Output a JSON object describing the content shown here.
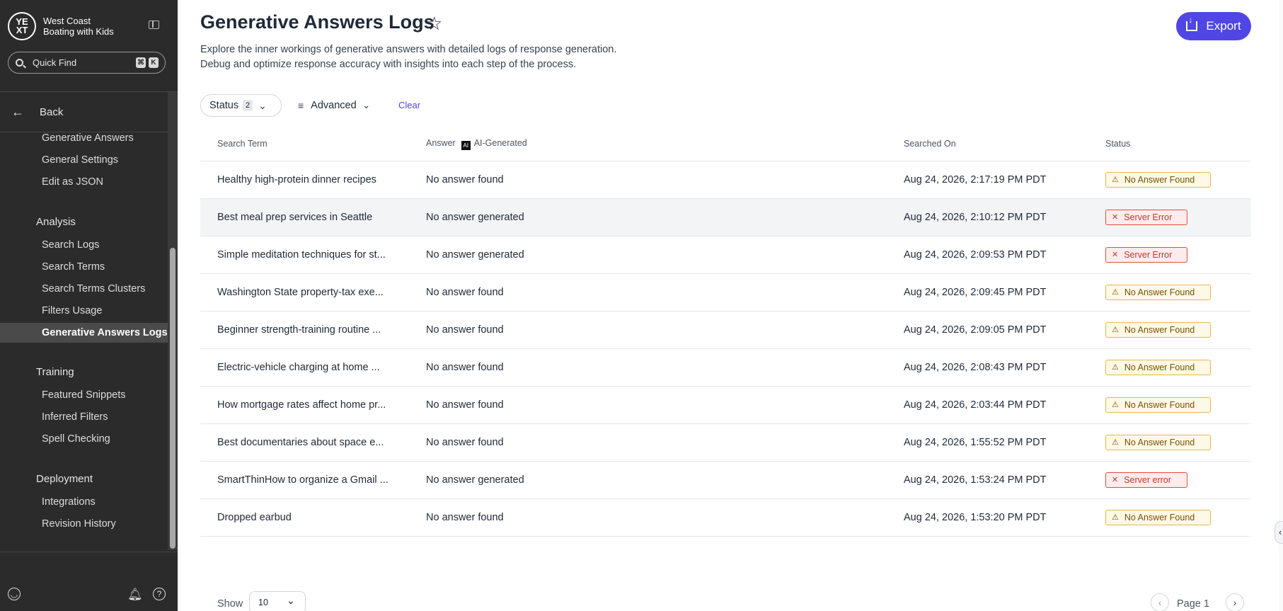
{
  "sidebar": {
    "logo_text": "YE\nXT",
    "brand_line1": "West Coast",
    "brand_line2": "Boating with Kids",
    "quick_find": "Quick Find",
    "kbd1": "⌘",
    "kbd2": "K",
    "back_label": "Back",
    "items_top": [
      "Generative Answers",
      "General Settings",
      "Edit as JSON"
    ],
    "analysis": {
      "title": "Analysis",
      "items": [
        "Search Logs",
        "Search Terms",
        "Search Terms Clusters",
        "Filters Usage",
        "Generative Answers Logs"
      ]
    },
    "training": {
      "title": "Training",
      "items": [
        "Featured Snippets",
        "Inferred Filters",
        "Spell Checking"
      ]
    },
    "deployment": {
      "title": "Deployment",
      "items": [
        "Integrations",
        "Revision History"
      ]
    }
  },
  "header": {
    "title": "Generative Answers Logs",
    "subtitle_line1": "Explore the inner workings of generative answers with detailed logs of response generation.",
    "subtitle_line2": "Debug and optimize response accuracy with insights into each step of the process.",
    "export_label": "Export"
  },
  "filters": {
    "status_label": "Status",
    "status_count": "2",
    "advanced_label": "Advanced",
    "clear_label": "Clear"
  },
  "table": {
    "columns": {
      "search_term": "Search Term",
      "answer": "Answer",
      "ai_generated": "AI-Generated",
      "ai_icon": "AI",
      "searched_on": "Searched On",
      "status": "Status"
    },
    "rows": [
      {
        "term": "Healthy high-protein dinner recipes",
        "answer": "No answer found",
        "date": "Aug 24, 2026, 2:17:19 PM PDT",
        "status": "No Answer Found",
        "type": "warn"
      },
      {
        "term": "Best meal prep services in Seattle",
        "answer": "No answer generated",
        "date": "Aug 24, 2026, 2:10:12 PM PDT",
        "status": "Server Error",
        "type": "err"
      },
      {
        "term": "Simple meditation techniques for st...",
        "answer": "No answer generated",
        "date": "Aug 24, 2026, 2:09:53 PM PDT",
        "status": "Server Error",
        "type": "err"
      },
      {
        "term": "Washington State property-tax exe...",
        "answer": "No answer found",
        "date": "Aug 24, 2026, 2:09:45 PM PDT",
        "status": "No Answer Found",
        "type": "warn"
      },
      {
        "term": "Beginner strength-training routine ...",
        "answer": "No answer found",
        "date": "Aug 24, 2026, 2:09:05 PM PDT",
        "status": "No Answer Found",
        "type": "warn"
      },
      {
        "term": "Electric-vehicle charging at home ...",
        "answer": "No answer found",
        "date": "Aug 24, 2026, 2:08:43 PM PDT",
        "status": "No Answer Found",
        "type": "warn"
      },
      {
        "term": "How mortgage rates affect home pr...",
        "answer": "No answer found",
        "date": "Aug 24, 2026, 2:03:44 PM PDT",
        "status": "No Answer Found",
        "type": "warn"
      },
      {
        "term": "Best documentaries about space e...",
        "answer": "No answer found",
        "date": "Aug 24, 2026, 1:55:52 PM PDT",
        "status": "No Answer Found",
        "type": "warn"
      },
      {
        "term": "SmartThinHow to organize a Gmail ...",
        "answer": "No answer generated",
        "date": "Aug 24, 2026, 1:53:24 PM PDT",
        "status": "Server error",
        "type": "err"
      },
      {
        "term": "Dropped earbud",
        "answer": "No answer found",
        "date": "Aug 24, 2026, 1:53:20 PM PDT",
        "status": "No Answer Found",
        "type": "warn"
      }
    ]
  },
  "pagination": {
    "show_label": "Show",
    "page_size": "10",
    "page_label": "Page 1"
  },
  "icons": {
    "warn": "⚠",
    "err": "✕"
  },
  "colors": {
    "sidebar_bg": "#2b2b2b",
    "accent": "#4f46e5",
    "warn_border": "#e6b84b",
    "error_border": "#e74c3c"
  }
}
